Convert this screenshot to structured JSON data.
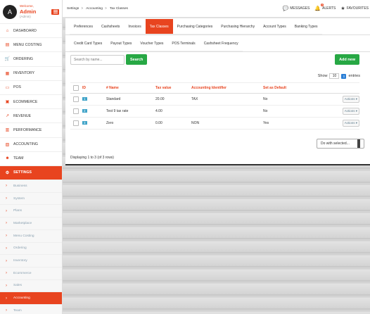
{
  "user": {
    "avatar_letter": "A",
    "welcome": "Welcome,",
    "name": "Admin",
    "role": "(Admin)"
  },
  "nav": [
    {
      "label": "DASHBOARD",
      "icon": "⌂"
    },
    {
      "label": "MENU COSTING",
      "icon": "▤"
    },
    {
      "label": "ORDERING",
      "icon": "🛒"
    },
    {
      "label": "INVENTORY",
      "icon": "▦"
    },
    {
      "label": "POS",
      "icon": "▭"
    },
    {
      "label": "ECOMMERCE",
      "icon": "▣"
    },
    {
      "label": "REVENUE",
      "icon": "↗"
    },
    {
      "label": "PERFORMANCE",
      "icon": "▥"
    },
    {
      "label": "ACCOUNTING",
      "icon": "▧"
    },
    {
      "label": "TEAM",
      "icon": "☻"
    },
    {
      "label": "SETTINGS",
      "icon": "⚙"
    }
  ],
  "submenu": [
    "Business",
    "System",
    "Plans",
    "Marketplace",
    "Menu Costing",
    "Ordering",
    "Inventory",
    "Ecommerce",
    "Sales",
    "Accounting",
    "Team"
  ],
  "breadcrumb": [
    "Settings",
    "Accounting",
    "Tax Classes"
  ],
  "top_actions": {
    "messages": "MESSAGES",
    "alerts": "ALERTS",
    "alerts_count": "8",
    "favourites": "FAVOURITES"
  },
  "tabs_row1": [
    "Preferences",
    "Cashsheets",
    "Invoices",
    "Tax Classes",
    "Purchasing Categories",
    "Purchasing Hierarchy",
    "Account Types",
    "Banking Types"
  ],
  "tabs_row2": [
    "Credit Card Types",
    "Payout Types",
    "Voucher Types",
    "POS Terminals",
    "Cashsheet Frequency"
  ],
  "search": {
    "placeholder": "Search by name...",
    "button": "Search"
  },
  "add_new": "Add new",
  "show": {
    "prefix": "Show",
    "value": "10",
    "suffix": "entries"
  },
  "table": {
    "headers": [
      "ID",
      "# Name",
      "Tax value",
      "Accounting Identifier",
      "Set as Default"
    ],
    "rows": [
      {
        "id": "1",
        "name": "Standard",
        "tax": "20.00",
        "ident": "TAX",
        "default": "No",
        "action": "Actions ▾"
      },
      {
        "id": "2",
        "name": "Test 9 tax rate",
        "tax": "4.00",
        "ident": "",
        "default": "No",
        "action": "Actions ▾"
      },
      {
        "id": "3",
        "name": "Zero",
        "tax": "0.00",
        "ident": "NON",
        "default": "Yes",
        "action": "Actions ▾"
      }
    ]
  },
  "with_selected": "Do with selected...",
  "displaying": "Displaying 1 to 3 (of 3 rows)",
  "colors": {
    "accent": "#e8441f",
    "green": "#27a844",
    "id_tag": "#3fa3c8"
  }
}
